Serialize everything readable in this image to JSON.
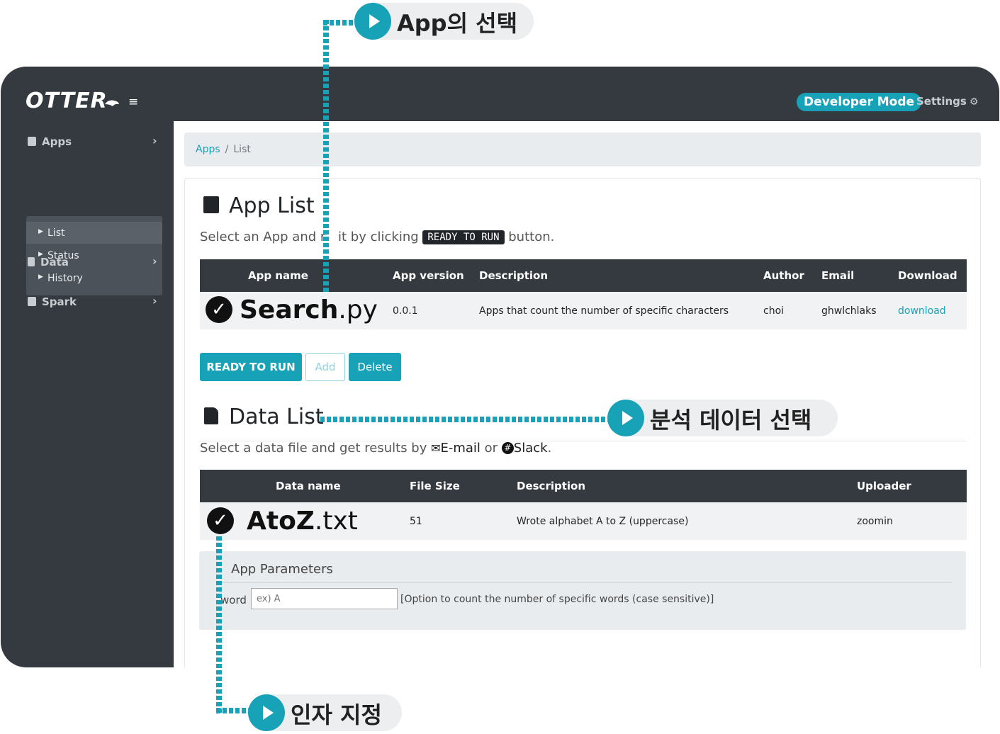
{
  "header": {
    "logo": "OTTER",
    "developer_mode": "Developer Mode",
    "settings": "Settings"
  },
  "sidebar": {
    "sections": [
      {
        "label": "Apps"
      },
      {
        "label": "Data"
      },
      {
        "label": "Spark"
      }
    ],
    "apps_submenu": [
      {
        "label": "List"
      },
      {
        "label": "Status"
      },
      {
        "label": "History"
      }
    ]
  },
  "breadcrumb": {
    "link": "Apps",
    "separator": "/",
    "current": "List"
  },
  "app_list": {
    "title": "App List",
    "subtitle_before": "Select an App and r",
    "subtitle_mid": " it by clicking ",
    "subtitle_kbd": "READY TO RUN",
    "subtitle_after": " button.",
    "columns": [
      "App name",
      "App version",
      "Description",
      "Author",
      "Email",
      "Download"
    ],
    "row": {
      "name_main": "Search",
      "name_ext": ".py",
      "version": "0.0.1",
      "description": "Apps that count the number of specific characters",
      "author": "choi",
      "email": "ghwlchlaks",
      "download": "download"
    },
    "buttons": {
      "run": "READY TO RUN",
      "add": "Add",
      "delete": "Delete"
    }
  },
  "data_list": {
    "title": "Data List",
    "subtitle_before": "Select a data file and get results by ",
    "email_label": "E-mail",
    "or": " or ",
    "slack_label": "Slack",
    "period": ".",
    "columns": [
      "Data name",
      "File Size",
      "Description",
      "Uploader"
    ],
    "row": {
      "name_main": "AtoZ",
      "name_ext": ".txt",
      "size": "51",
      "description": "Wrote alphabet A to Z (uppercase)",
      "uploader": "zoomin"
    }
  },
  "params": {
    "title": "App Parameters",
    "label": "word",
    "placeholder": "ex) A",
    "help": "[Option to count the number of specific words (case sensitive)]"
  },
  "annotations": {
    "select_app": "App의 선택",
    "select_data": "분석 데이터 선택",
    "set_args": "인자 지정"
  },
  "colors": {
    "accent": "#17a2b8",
    "dark": "#343a40"
  }
}
